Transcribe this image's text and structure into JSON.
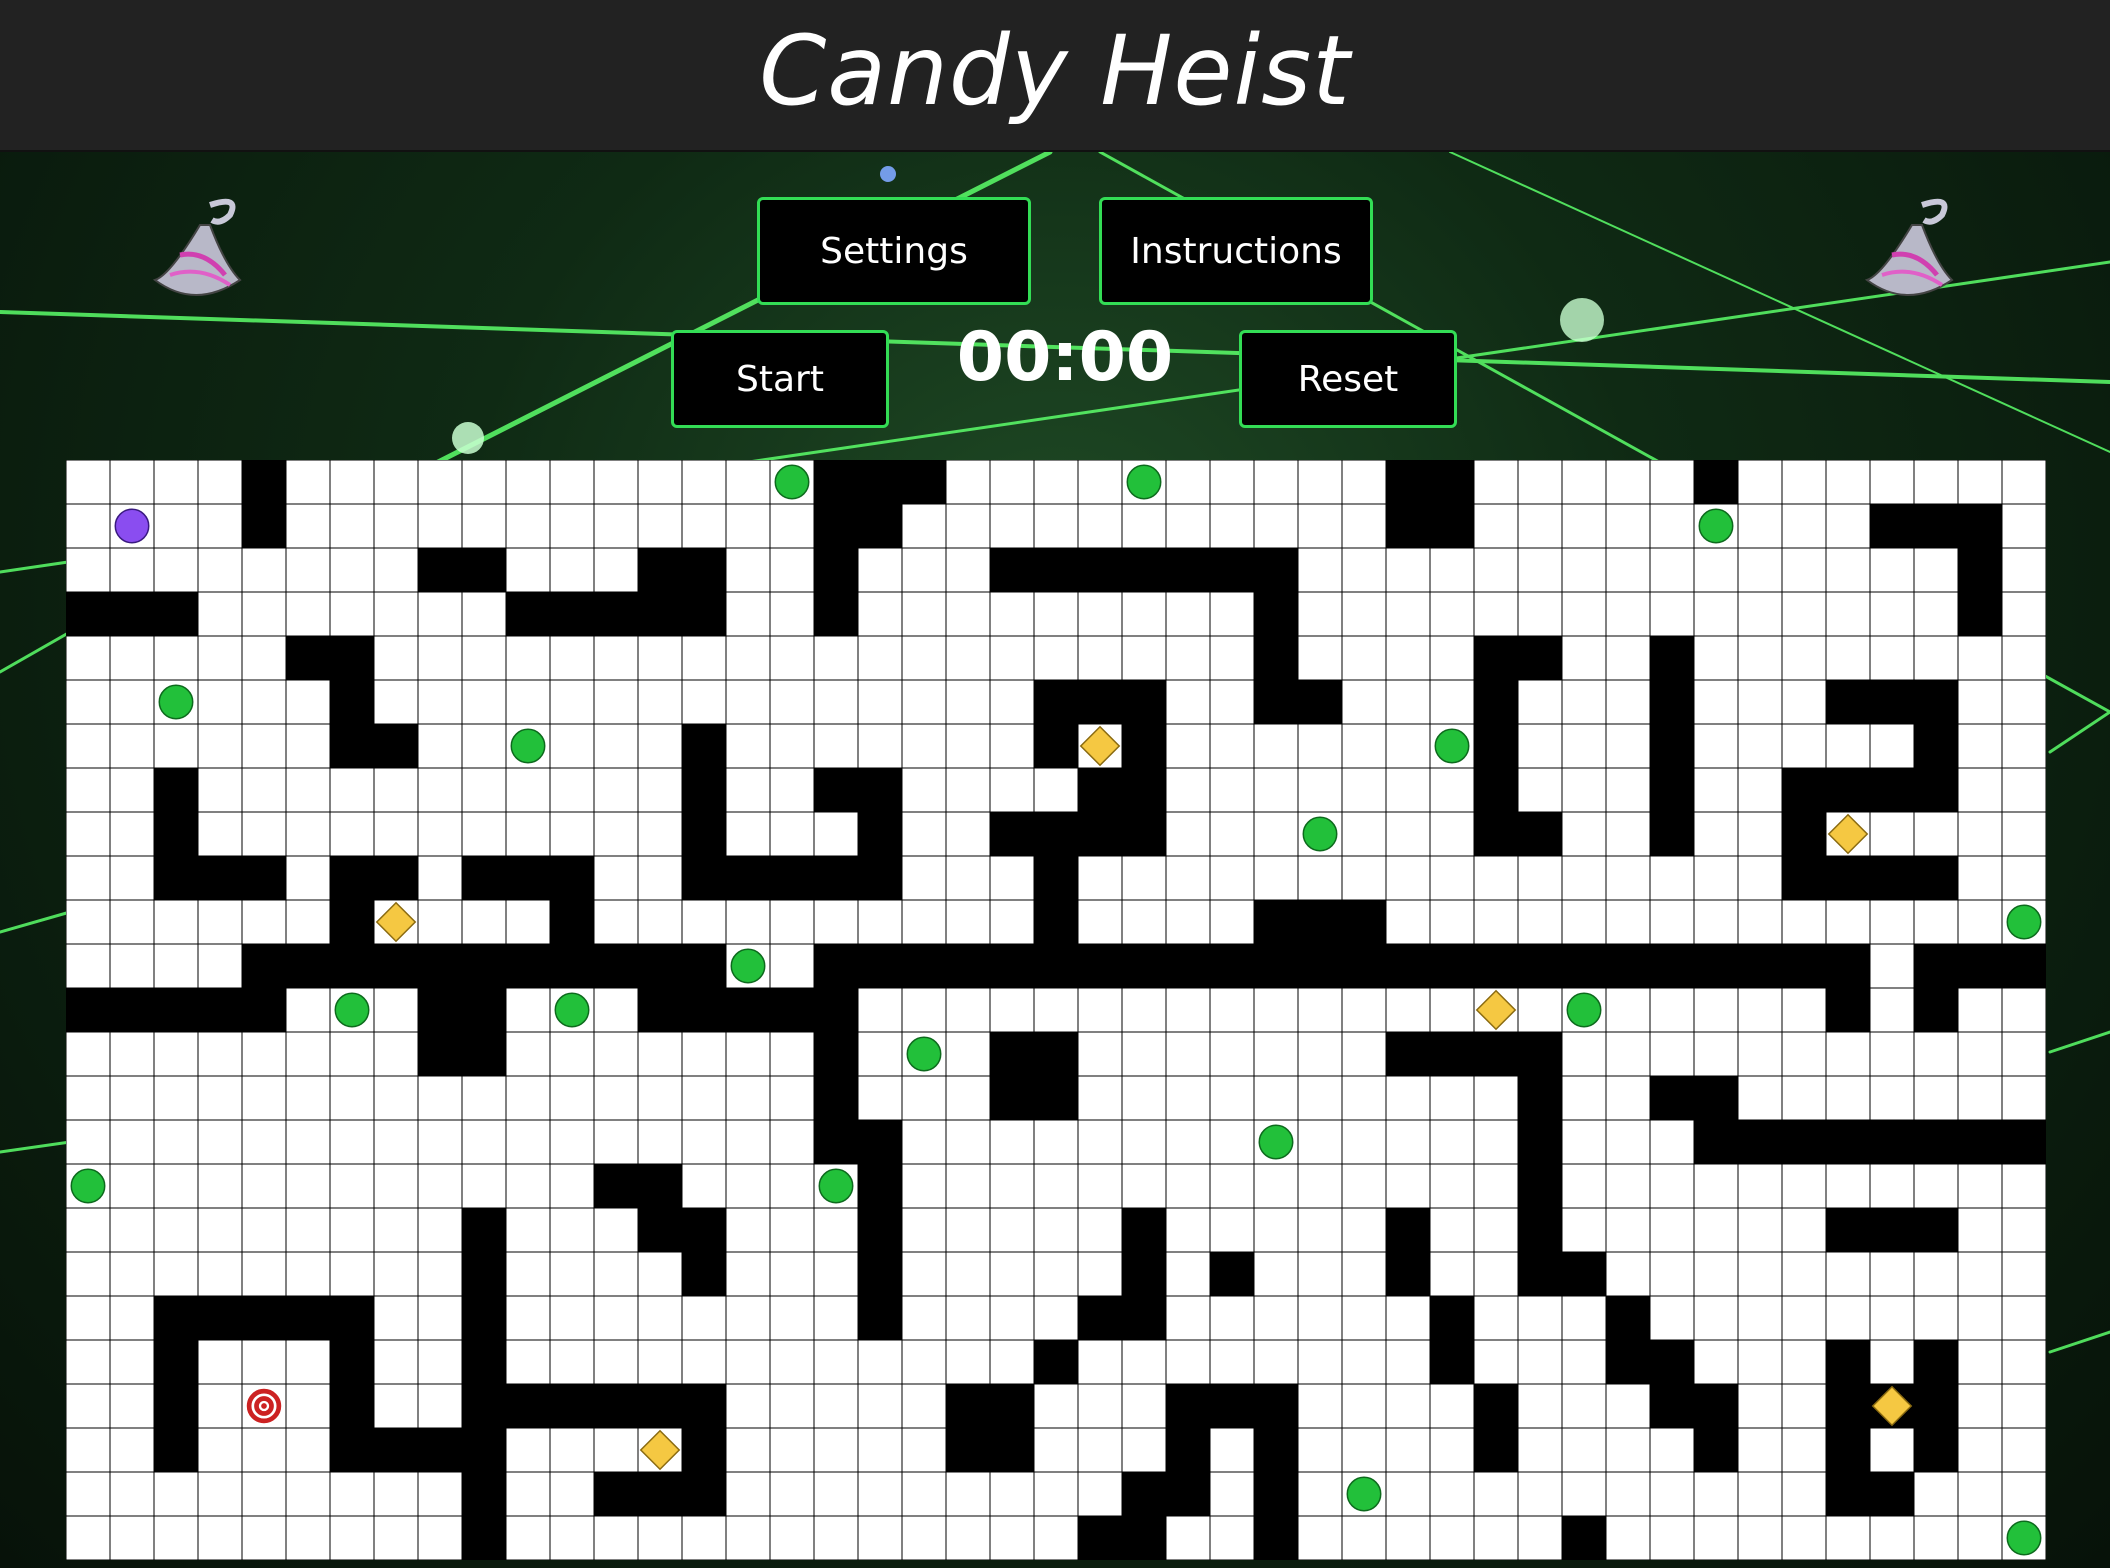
{
  "header": {
    "title": "Candy Heist"
  },
  "controls": {
    "settings_label": "Settings",
    "instructions_label": "Instructions",
    "start_label": "Start",
    "reset_label": "Reset",
    "timer": "00:00"
  },
  "colors": {
    "button_border": "#33dd55",
    "wall": "#000000",
    "floor": "#ffffff",
    "gridline": "#000000",
    "candy_green": "#22c03a",
    "gem_yellow": "#f5c842",
    "player_purple": "#8a4df0",
    "goal_red": "#cc2222"
  },
  "maze": {
    "cols": 45,
    "rows": 25,
    "walls": [
      [
        4,
        0
      ],
      [
        4,
        1
      ],
      [
        17,
        0
      ],
      [
        18,
        0
      ],
      [
        19,
        0
      ],
      [
        17,
        1
      ],
      [
        18,
        1
      ],
      [
        30,
        0
      ],
      [
        31,
        0
      ],
      [
        30,
        1
      ],
      [
        31,
        1
      ],
      [
        37,
        0
      ],
      [
        41,
        1
      ],
      [
        42,
        1
      ],
      [
        43,
        1
      ],
      [
        43,
        2
      ],
      [
        43,
        3
      ],
      [
        43,
        3
      ],
      [
        8,
        2
      ],
      [
        9,
        2
      ],
      [
        13,
        2
      ],
      [
        14,
        2
      ],
      [
        10,
        3
      ],
      [
        11,
        3
      ],
      [
        12,
        3
      ],
      [
        13,
        3
      ],
      [
        14,
        3
      ],
      [
        0,
        3
      ],
      [
        1,
        3
      ],
      [
        2,
        3
      ],
      [
        17,
        2
      ],
      [
        17,
        3
      ],
      [
        21,
        2
      ],
      [
        22,
        2
      ],
      [
        23,
        2
      ],
      [
        24,
        2
      ],
      [
        25,
        2
      ],
      [
        26,
        2
      ],
      [
        27,
        2
      ],
      [
        27,
        3
      ],
      [
        27,
        4
      ],
      [
        27,
        5
      ],
      [
        28,
        5
      ],
      [
        5,
        4
      ],
      [
        6,
        4
      ],
      [
        6,
        5
      ],
      [
        6,
        6
      ],
      [
        7,
        6
      ],
      [
        32,
        4
      ],
      [
        33,
        4
      ],
      [
        32,
        5
      ],
      [
        32,
        6
      ],
      [
        32,
        7
      ],
      [
        32,
        8
      ],
      [
        33,
        8
      ],
      [
        36,
        4
      ],
      [
        36,
        5
      ],
      [
        36,
        6
      ],
      [
        36,
        7
      ],
      [
        36,
        8
      ],
      [
        40,
        5
      ],
      [
        41,
        5
      ],
      [
        42,
        5
      ],
      [
        42,
        6
      ],
      [
        42,
        7
      ],
      [
        41,
        7
      ],
      [
        40,
        7
      ],
      [
        39,
        7
      ],
      [
        39,
        8
      ],
      [
        39,
        9
      ],
      [
        40,
        9
      ],
      [
        41,
        9
      ],
      [
        42,
        9
      ],
      [
        22,
        5
      ],
      [
        23,
        5
      ],
      [
        24,
        5
      ],
      [
        24,
        6
      ],
      [
        24,
        7
      ],
      [
        24,
        8
      ],
      [
        22,
        6
      ],
      [
        23,
        7
      ],
      [
        21,
        8
      ],
      [
        22,
        8
      ],
      [
        23,
        8
      ],
      [
        22,
        9
      ],
      [
        22,
        10
      ],
      [
        14,
        6
      ],
      [
        14,
        7
      ],
      [
        14,
        8
      ],
      [
        14,
        9
      ],
      [
        15,
        9
      ],
      [
        16,
        9
      ],
      [
        17,
        9
      ],
      [
        18,
        9
      ],
      [
        17,
        7
      ],
      [
        18,
        7
      ],
      [
        18,
        8
      ],
      [
        2,
        7
      ],
      [
        2,
        8
      ],
      [
        2,
        9
      ],
      [
        3,
        9
      ],
      [
        4,
        9
      ],
      [
        6,
        9
      ],
      [
        7,
        9
      ],
      [
        6,
        10
      ],
      [
        9,
        9
      ],
      [
        10,
        9
      ],
      [
        11,
        9
      ],
      [
        11,
        10
      ],
      [
        27,
        10
      ],
      [
        28,
        10
      ],
      [
        29,
        10
      ],
      [
        4,
        11
      ],
      [
        5,
        11
      ],
      [
        6,
        11
      ],
      [
        7,
        11
      ],
      [
        8,
        11
      ],
      [
        9,
        11
      ],
      [
        10,
        11
      ],
      [
        11,
        11
      ],
      [
        12,
        11
      ],
      [
        13,
        11
      ],
      [
        14,
        11
      ],
      [
        17,
        11
      ],
      [
        18,
        11
      ],
      [
        19,
        11
      ],
      [
        20,
        11
      ],
      [
        21,
        11
      ],
      [
        22,
        11
      ],
      [
        23,
        11
      ],
      [
        24,
        11
      ],
      [
        25,
        11
      ],
      [
        26,
        11
      ],
      [
        27,
        11
      ],
      [
        28,
        11
      ],
      [
        29,
        11
      ],
      [
        30,
        11
      ],
      [
        31,
        11
      ],
      [
        32,
        11
      ],
      [
        33,
        11
      ],
      [
        34,
        11
      ],
      [
        35,
        11
      ],
      [
        36,
        11
      ],
      [
        37,
        11
      ],
      [
        38,
        11
      ],
      [
        39,
        11
      ],
      [
        40,
        11
      ],
      [
        42,
        11
      ],
      [
        43,
        11
      ],
      [
        44,
        11
      ],
      [
        0,
        12
      ],
      [
        1,
        12
      ],
      [
        2,
        12
      ],
      [
        3,
        12
      ],
      [
        4,
        12
      ],
      [
        8,
        12
      ],
      [
        9,
        12
      ],
      [
        13,
        12
      ],
      [
        14,
        12
      ],
      [
        15,
        12
      ],
      [
        16,
        12
      ],
      [
        17,
        12
      ],
      [
        40,
        12
      ],
      [
        42,
        12
      ],
      [
        8,
        13
      ],
      [
        9,
        13
      ],
      [
        17,
        13
      ],
      [
        21,
        13
      ],
      [
        22,
        13
      ],
      [
        30,
        13
      ],
      [
        31,
        13
      ],
      [
        32,
        13
      ],
      [
        33,
        13
      ],
      [
        17,
        14
      ],
      [
        21,
        14
      ],
      [
        22,
        14
      ],
      [
        33,
        14
      ],
      [
        36,
        14
      ],
      [
        37,
        14
      ],
      [
        17,
        15
      ],
      [
        18,
        15
      ],
      [
        33,
        15
      ],
      [
        37,
        15
      ],
      [
        38,
        15
      ],
      [
        39,
        15
      ],
      [
        40,
        15
      ],
      [
        41,
        15
      ],
      [
        42,
        15
      ],
      [
        43,
        15
      ],
      [
        44,
        15
      ],
      [
        18,
        16
      ],
      [
        33,
        16
      ],
      [
        12,
        16
      ],
      [
        13,
        16
      ],
      [
        13,
        17
      ],
      [
        14,
        17
      ],
      [
        14,
        18
      ],
      [
        18,
        17
      ],
      [
        18,
        18
      ],
      [
        18,
        19
      ],
      [
        33,
        17
      ],
      [
        33,
        18
      ],
      [
        34,
        18
      ],
      [
        35,
        19
      ],
      [
        35,
        20
      ],
      [
        36,
        20
      ],
      [
        36,
        21
      ],
      [
        37,
        21
      ],
      [
        37,
        22
      ],
      [
        9,
        17
      ],
      [
        9,
        18
      ],
      [
        9,
        19
      ],
      [
        9,
        20
      ],
      [
        9,
        21
      ],
      [
        9,
        22
      ],
      [
        9,
        23
      ],
      [
        9,
        24
      ],
      [
        24,
        17
      ],
      [
        24,
        18
      ],
      [
        24,
        19
      ],
      [
        23,
        19
      ],
      [
        22,
        20
      ],
      [
        21,
        21
      ],
      [
        20,
        21
      ],
      [
        20,
        22
      ],
      [
        21,
        22
      ],
      [
        30,
        17
      ],
      [
        30,
        18
      ],
      [
        31,
        19
      ],
      [
        31,
        20
      ],
      [
        32,
        21
      ],
      [
        32,
        22
      ],
      [
        31,
        20
      ],
      [
        26,
        18
      ],
      [
        40,
        17
      ],
      [
        41,
        17
      ],
      [
        42,
        17
      ],
      [
        2,
        19
      ],
      [
        3,
        19
      ],
      [
        4,
        19
      ],
      [
        5,
        19
      ],
      [
        6,
        19
      ],
      [
        6,
        20
      ],
      [
        6,
        21
      ],
      [
        6,
        22
      ],
      [
        7,
        22
      ],
      [
        8,
        22
      ],
      [
        2,
        20
      ],
      [
        2,
        21
      ],
      [
        2,
        22
      ],
      [
        10,
        21
      ],
      [
        11,
        21
      ],
      [
        12,
        21
      ],
      [
        13,
        21
      ],
      [
        14,
        21
      ],
      [
        14,
        22
      ],
      [
        14,
        23
      ],
      [
        13,
        23
      ],
      [
        12,
        23
      ],
      [
        25,
        21
      ],
      [
        26,
        21
      ],
      [
        27,
        21
      ],
      [
        27,
        22
      ],
      [
        27,
        23
      ],
      [
        27,
        24
      ],
      [
        25,
        22
      ],
      [
        25,
        23
      ],
      [
        40,
        20
      ],
      [
        40,
        21
      ],
      [
        41,
        21
      ],
      [
        42,
        20
      ],
      [
        42,
        21
      ],
      [
        42,
        22
      ],
      [
        40,
        22
      ],
      [
        40,
        23
      ],
      [
        41,
        23
      ],
      [
        24,
        23
      ],
      [
        24,
        24
      ],
      [
        23,
        24
      ],
      [
        34,
        24
      ]
    ],
    "candies": [
      [
        16,
        0
      ],
      [
        24,
        0
      ],
      [
        37,
        1
      ],
      [
        2,
        5
      ],
      [
        10,
        6
      ],
      [
        31,
        6
      ],
      [
        28,
        8
      ],
      [
        44,
        10
      ],
      [
        15,
        11
      ],
      [
        6,
        12
      ],
      [
        11,
        12
      ],
      [
        34,
        12
      ],
      [
        19,
        13
      ],
      [
        27,
        15
      ],
      [
        0,
        16
      ],
      [
        17,
        16
      ],
      [
        29,
        23
      ],
      [
        44,
        24
      ]
    ],
    "gems": [
      [
        23,
        6
      ],
      [
        40,
        8
      ],
      [
        7,
        10
      ],
      [
        32,
        12
      ],
      [
        13,
        22
      ],
      [
        41,
        21
      ]
    ],
    "player": [
      1,
      1
    ],
    "goal": [
      4,
      21
    ]
  }
}
